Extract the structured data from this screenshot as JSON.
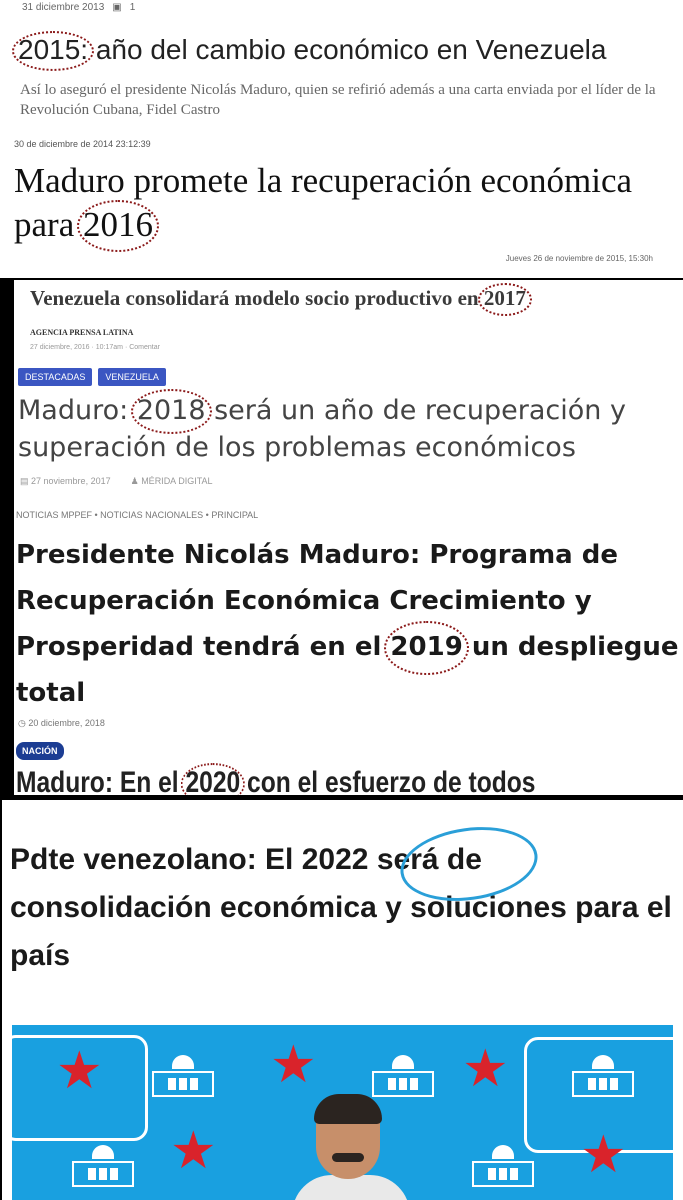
{
  "article1": {
    "meta_date": "31 diciembre 2013",
    "meta_comments": "1",
    "title_year": "2015:",
    "title_rest": " año del cambio económico en Venezuela",
    "subtitle": "Así lo aseguró el presidente Nicolás Maduro, quien se refirió además a una carta enviada por el líder de la Revolución Cubana, Fidel Castro"
  },
  "article2": {
    "date": "30 de diciembre de 2014 23:12:39",
    "title_before": "Maduro promete la recuperación económica para ",
    "title_year": "2016",
    "stamp": "Jueves 26 de noviembre de 2015, 15:30h"
  },
  "article3": {
    "title_before": "Venezuela consolidará modelo socio productivo en ",
    "title_year": "2017",
    "agency": "AGENCIA PRENSA LATINA",
    "meta": "27 diciembre, 2016 · 10:17am · Comentar"
  },
  "article4": {
    "badges": [
      "DESTACADAS",
      "VENEZUELA"
    ],
    "title_before": "Maduro: ",
    "title_year": "2018",
    "title_after": " será un año de recuperación y superación de los problemas económicos",
    "date": "27 noviembre, 2017",
    "author": "MÉRIDA DIGITAL"
  },
  "article5": {
    "categories": "NOTICIAS MPPEF • NOTICIAS NACIONALES • PRINCIPAL",
    "title_before": "Presidente Nicolás Maduro: Programa de Recuperación Económica Crecimiento y Prosperidad tendrá en el ",
    "title_year": "2019",
    "title_after": " un despliegue total",
    "date": "20 diciembre, 2018"
  },
  "article6": {
    "badge": "NACIÓN",
    "title_before": "Maduro: En el ",
    "title_year": "2020",
    "title_after": " con el esfuerzo de todos"
  },
  "article7": {
    "title_before": "Pdte venezolano: El ",
    "title_year": "2022",
    "title_after": " será de consolidación económica y soluciones para el país"
  },
  "icons": [
    "comment-icon",
    "clock-icon",
    "user-icon",
    "star-icon",
    "building-icon"
  ],
  "colors": {
    "badge_blue": "#3b56c2",
    "nacion_blue": "#1c3d93",
    "circle_dotted": "#8b1a1a",
    "circle_blue": "#2a9fd8",
    "photo_bg": "#19a0e0",
    "star_red": "#d9232b"
  }
}
